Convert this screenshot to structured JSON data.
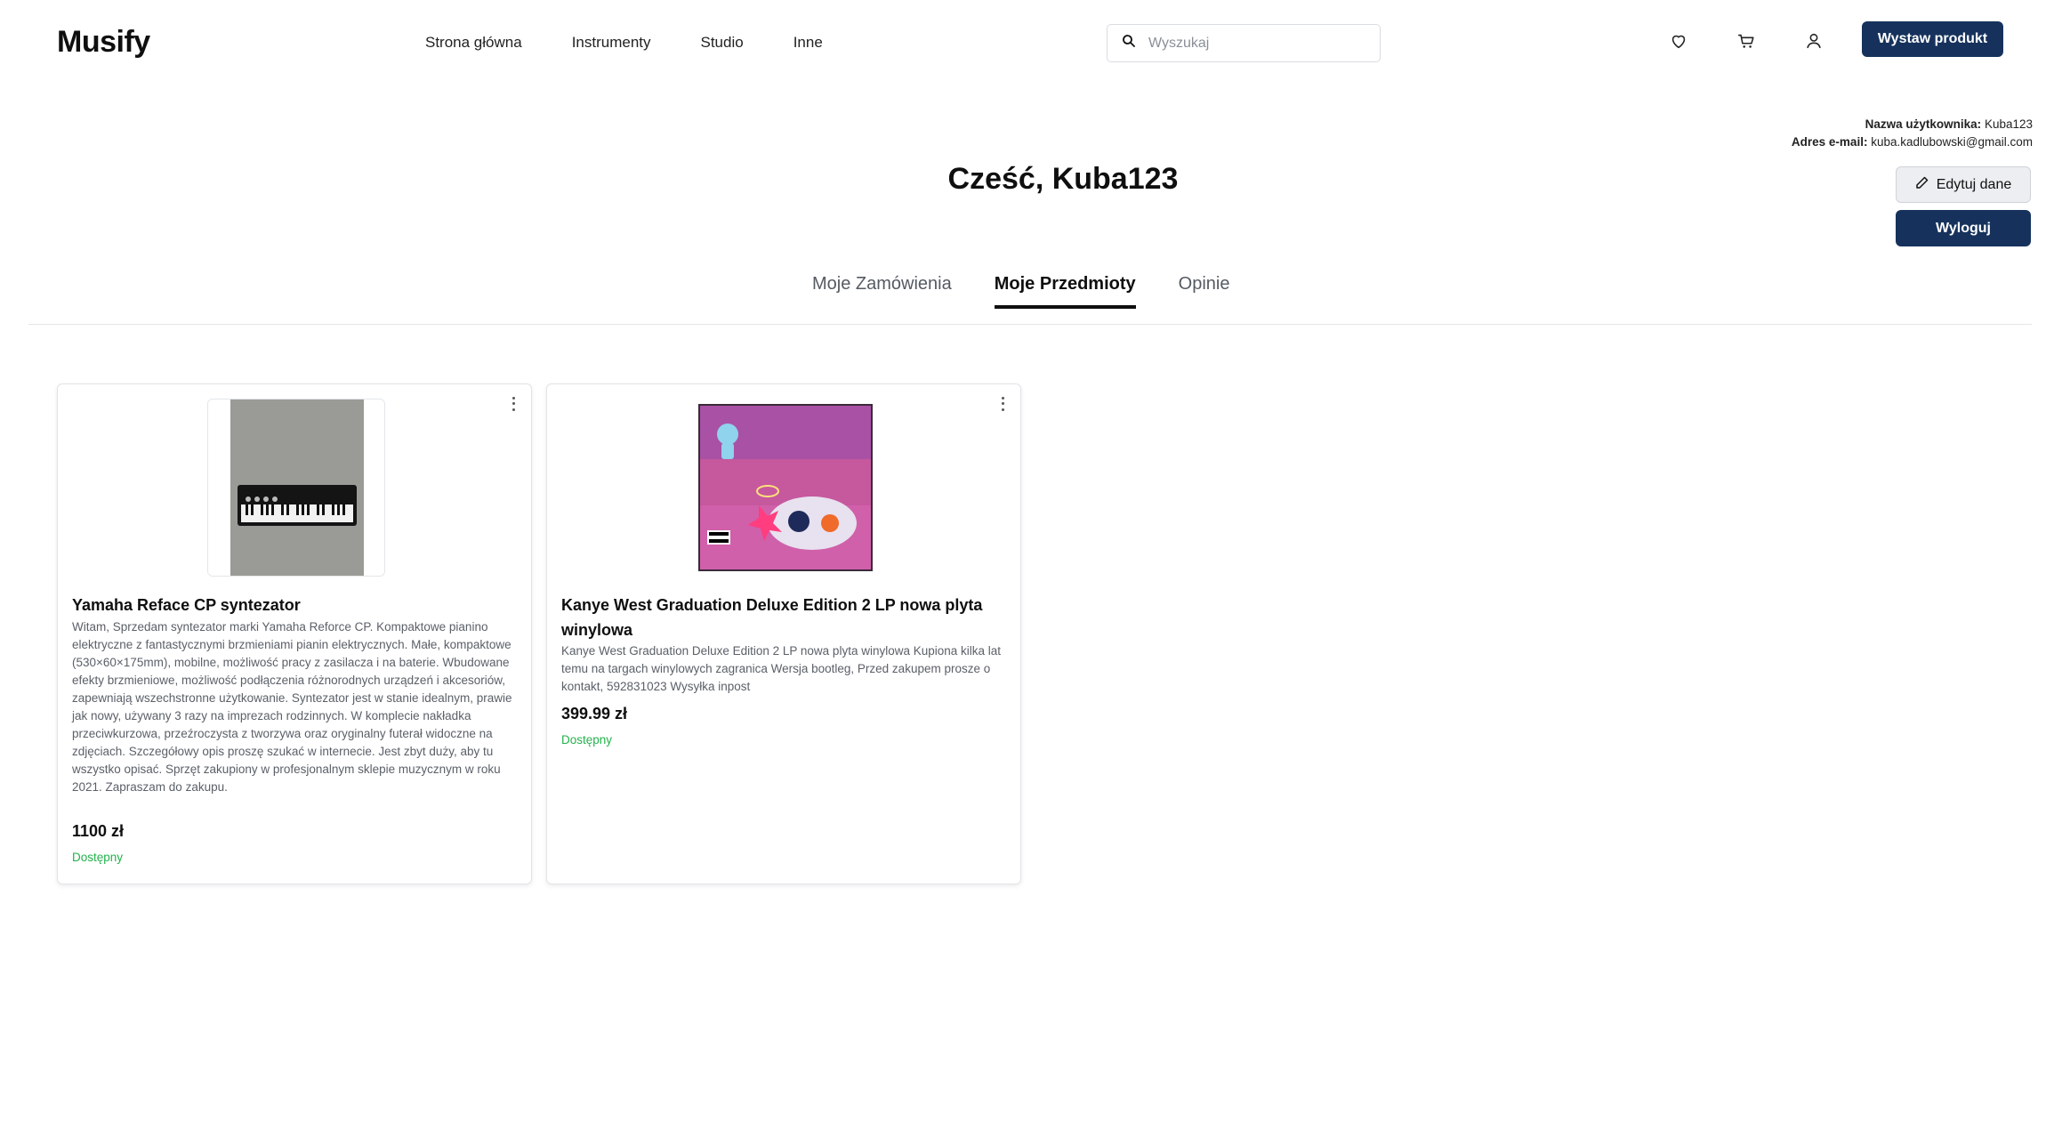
{
  "header": {
    "logo": "Musify",
    "nav": [
      "Strona główna",
      "Instrumenty",
      "Studio",
      "Inne"
    ],
    "search_placeholder": "Wyszukaj",
    "icons": [
      "heart-icon",
      "cart-icon",
      "user-icon"
    ],
    "cta_label": "Wystaw produkt"
  },
  "profile": {
    "username_label": "Nazwa użytkownika:",
    "username": "Kuba123",
    "email_label": "Adres e-mail:",
    "email": "kuba.kadlubowski@gmail.com",
    "edit_label": "Edytuj dane",
    "logout_label": "Wyloguj",
    "greeting": "Cześć, Kuba123"
  },
  "tabs": [
    {
      "label": "Moje Zamówienia",
      "active": false
    },
    {
      "label": "Moje Przedmioty",
      "active": true
    },
    {
      "label": "Opinie",
      "active": false
    }
  ],
  "items": [
    {
      "title": "Yamaha Reface CP syntezator",
      "description": "Witam, Sprzedam syntezator marki Yamaha Reforce CP. Kompaktowe pianino elektryczne z fantastycznymi brzmieniami pianin elektrycznych. Małe, kompaktowe (530×60×175mm), mobilne, możliwość pracy z zasilacza i na baterie. Wbudowane efekty brzmieniowe, możliwość podłączenia różnorodnych urządzeń i akcesoriów, zapewniają wszechstronne użytkowanie. Syntezator jest w stanie idealnym, prawie jak nowy, używany 3 razy na imprezach rodzinnych. W komplecie nakładka przeciwkurzowa, przeźroczysta z tworzywa oraz oryginalny futerał widoczne na zdjęciach. Szczegółowy opis proszę szukać w internecie. Jest zbyt duży, aby tu wszystko opisać. Sprzęt zakupiony w profesjonalnym sklepie muzycznym w roku 2021. Zapraszam do zakupu.",
      "price": "1100 zł",
      "status": "Dostępny"
    },
    {
      "title": "Kanye West Graduation Deluxe Edition 2 LP nowa plyta winylowa",
      "description": "Kanye West Graduation Deluxe Edition 2 LP nowa plyta winylowa Kupiona kilka lat temu na targach winylowych zagranica Wersja bootleg, Przed zakupem prosze o kontakt, 592831023 Wysyłka inpost",
      "price": "399.99 zł",
      "status": "Dostępny"
    }
  ],
  "colors": {
    "primary": "#16325c",
    "available": "#22b24c"
  }
}
